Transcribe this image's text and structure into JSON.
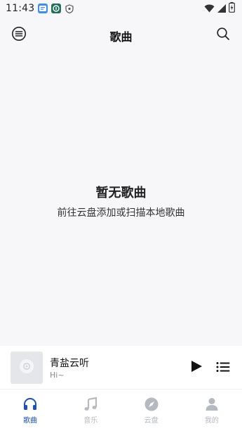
{
  "status_bar": {
    "time": "11:43",
    "app_icons": [
      "messenger-app-icon",
      "security-app-icon",
      "shield-app-icon"
    ],
    "right_icons": [
      "wifi-icon",
      "signal-icon",
      "battery-charging-icon"
    ]
  },
  "header": {
    "title": "歌曲",
    "menu_icon": "menu-icon",
    "search_icon": "search-icon"
  },
  "empty_state": {
    "title": "暂无歌曲",
    "subtitle": "前往云盘添加或扫描本地歌曲"
  },
  "player": {
    "title": "青盐云听",
    "subtitle": "Hi~",
    "play_icon": "play-icon",
    "playlist_icon": "playlist-icon"
  },
  "nav": {
    "items": [
      {
        "label": "歌曲",
        "icon": "headphones-icon",
        "active": true
      },
      {
        "label": "音乐",
        "icon": "music-note-icon",
        "active": false
      },
      {
        "label": "云盘",
        "icon": "compass-icon",
        "active": false
      },
      {
        "label": "我的",
        "icon": "person-icon",
        "active": false
      }
    ]
  },
  "colors": {
    "accent": "#1a4fc4",
    "inactive": "#b5b9c0",
    "background": "#f7f7f9"
  }
}
